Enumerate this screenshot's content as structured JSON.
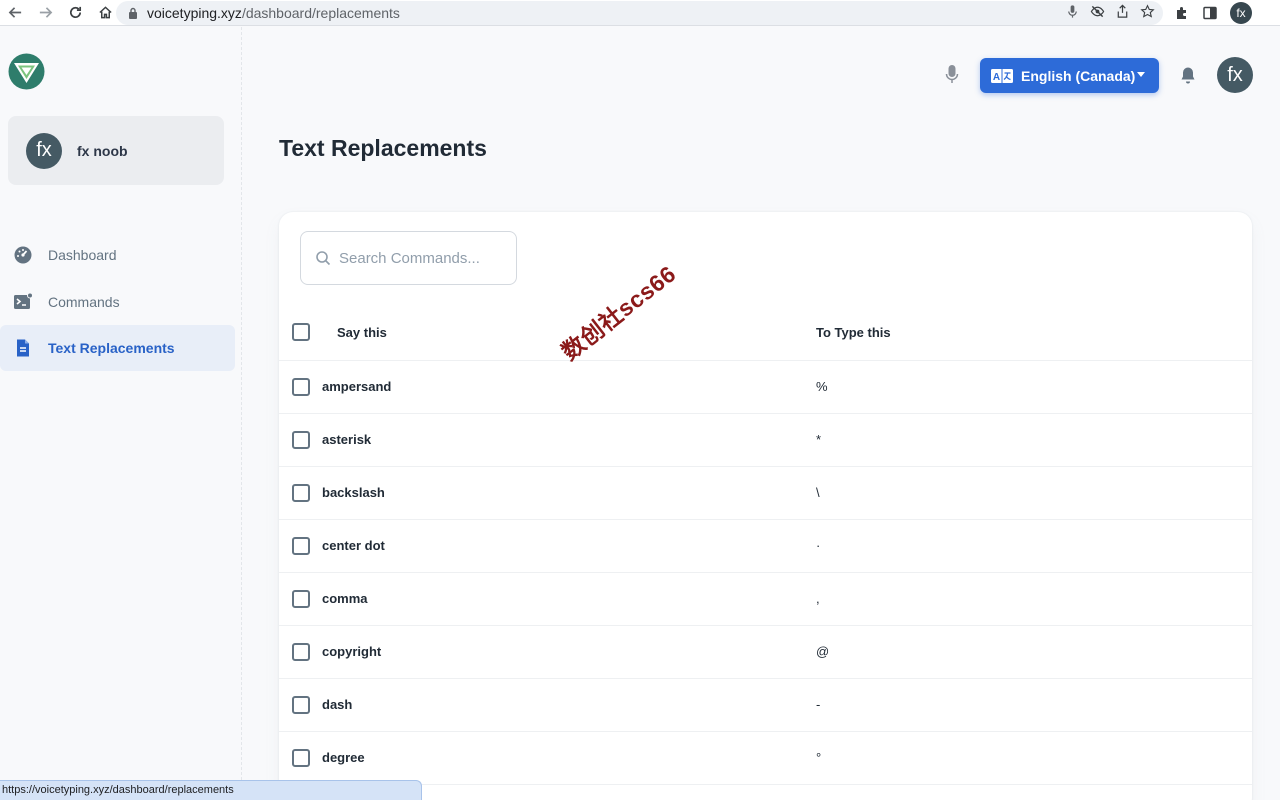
{
  "browser": {
    "url_host": "voicetyping.xyz",
    "url_path": "/dashboard/replacements",
    "profile_initials": "fx",
    "status_url": "https://voicetyping.xyz/dashboard/replacements"
  },
  "sidebar": {
    "user": {
      "initials": "fx",
      "name": "fx noob"
    },
    "items": [
      {
        "label": "Dashboard",
        "icon": "gauge-icon",
        "active": false
      },
      {
        "label": "Commands",
        "icon": "terminal-icon",
        "active": false
      },
      {
        "label": "Text Replacements",
        "icon": "document-icon",
        "active": true
      }
    ]
  },
  "header": {
    "language": "English (Canada)",
    "avatar_initials": "fx"
  },
  "page": {
    "title": "Text Replacements",
    "search_placeholder": "Search Commands...",
    "columns": {
      "say": "Say this",
      "type": "To Type this"
    },
    "rows": [
      {
        "say": "ampersand",
        "type": "%"
      },
      {
        "say": "asterisk",
        "type": "*"
      },
      {
        "say": "backslash",
        "type": "\\"
      },
      {
        "say": "center dot",
        "type": "·"
      },
      {
        "say": "comma",
        "type": ","
      },
      {
        "say": "copyright",
        "type": "@"
      },
      {
        "say": "dash",
        "type": "-"
      },
      {
        "say": "degree",
        "type": "°"
      }
    ]
  },
  "watermark": "数创社scs66",
  "colors": {
    "accent": "#2d6bd8",
    "active_nav_bg": "#e8eef8",
    "avatar": "#455a64"
  }
}
